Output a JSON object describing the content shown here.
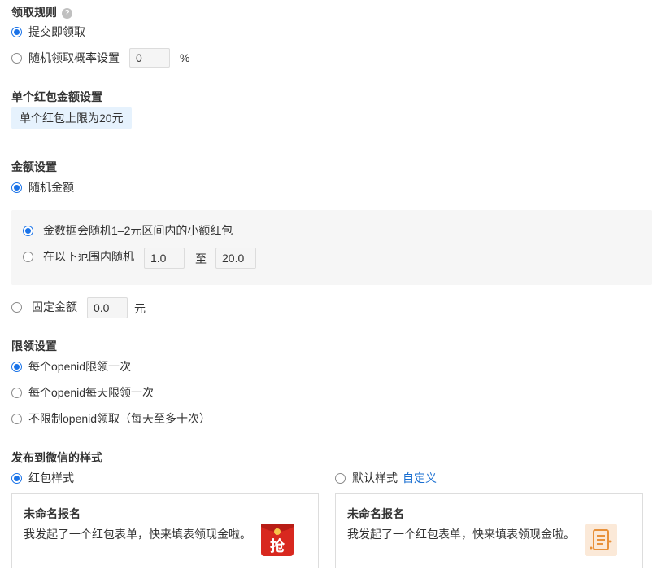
{
  "claim_rules": {
    "title": "领取规则",
    "help_icon": "?",
    "options": [
      {
        "label": "提交即领取",
        "checked": true
      },
      {
        "label": "随机领取概率设置",
        "checked": false
      }
    ],
    "probability_value": "0",
    "probability_unit": "%"
  },
  "single_amount": {
    "title": "单个红包金额设置",
    "limit_tag": "单个红包上限为20元"
  },
  "amount_setting": {
    "title": "金额设置",
    "random_label": "随机金额",
    "random_checked": true,
    "sub_options": [
      {
        "label": "金数据会随机1–2元区间内的小额红包",
        "checked": true
      },
      {
        "label": "在以下范围内随机",
        "checked": false
      }
    ],
    "range_min": "1.0",
    "range_to": "至",
    "range_max": "20.0",
    "fixed_label": "固定金额",
    "fixed_checked": false,
    "fixed_value": "0.0",
    "fixed_unit": "元"
  },
  "limit_setting": {
    "title": "限领设置",
    "options": [
      {
        "label": "每个openid限领一次",
        "checked": true
      },
      {
        "label": "每个openid每天限领一次",
        "checked": false
      },
      {
        "label": "不限制openid领取（每天至多十次）",
        "checked": false
      }
    ]
  },
  "wechat_style": {
    "title": "发布到微信的样式",
    "red_packet_label": "红包样式",
    "red_packet_checked": true,
    "default_label": "默认样式",
    "default_checked": false,
    "customize_link": "自定义",
    "red_card": {
      "title": "未命名报名",
      "desc": "我发起了一个红包表单，快来填表领现金啦。",
      "icon_char": "抢",
      "icon_color": "#d8281f"
    },
    "default_card": {
      "title": "未命名报名",
      "desc": "我发起了一个红包表单，快来填表领现金啦。",
      "icon_color": "#e8913a"
    }
  },
  "colors": {
    "accent": "#1a73e8",
    "tag_bg": "#e6f2fd",
    "panel_bg": "#f6f6f6"
  }
}
